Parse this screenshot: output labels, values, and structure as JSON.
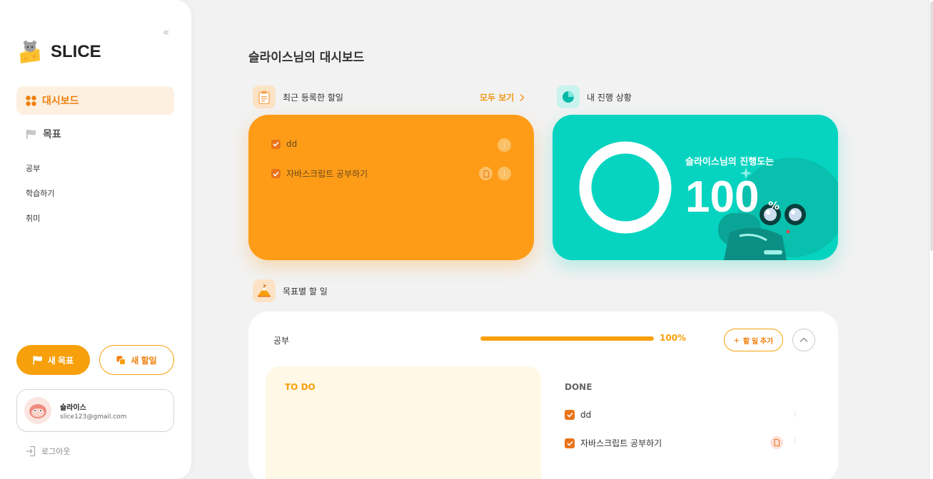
{
  "app": {
    "name": "SLICE"
  },
  "sidebar": {
    "collapse_label": "«",
    "nav": [
      {
        "label": "대시보드",
        "icon": "dashboard-grid-icon",
        "active": true
      },
      {
        "label": "목표",
        "icon": "flag-icon",
        "active": false
      }
    ],
    "goals": [
      "공부",
      "학습하기",
      "취미"
    ],
    "new_goal_label": "새 목표",
    "new_task_label": "새 할일",
    "user": {
      "name": "슬라이스",
      "email": "slice123@gmail.com"
    },
    "logout_label": "로그아웃"
  },
  "main": {
    "title": "슬라이스님의 대시보드",
    "recent": {
      "title": "최근 등록한 할일",
      "see_all": "모두 보기",
      "items": [
        {
          "label": "dd",
          "done": true,
          "has_memo": false
        },
        {
          "label": "자바스크립트 공부하기",
          "done": true,
          "has_memo": true
        }
      ]
    },
    "progress": {
      "title": "내 진행 상황",
      "label": "슬라이스님의 진행도는",
      "value": "100",
      "unit": "%"
    },
    "goal_tasks": {
      "title": "목표별 할 일",
      "goal": {
        "name": "공부",
        "progress_value": 100,
        "progress_label": "100%",
        "add_label": "할 일 추가",
        "todo_title": "TO DO",
        "done_title": "DONE",
        "done_items": [
          {
            "label": "dd",
            "has_memo": false
          },
          {
            "label": "자바스크립트 공부하기",
            "has_memo": true
          }
        ]
      }
    }
  },
  "colors": {
    "accent": "#f7a00c",
    "teal": "#06d4c0",
    "orange_card": "#fe9c17"
  }
}
